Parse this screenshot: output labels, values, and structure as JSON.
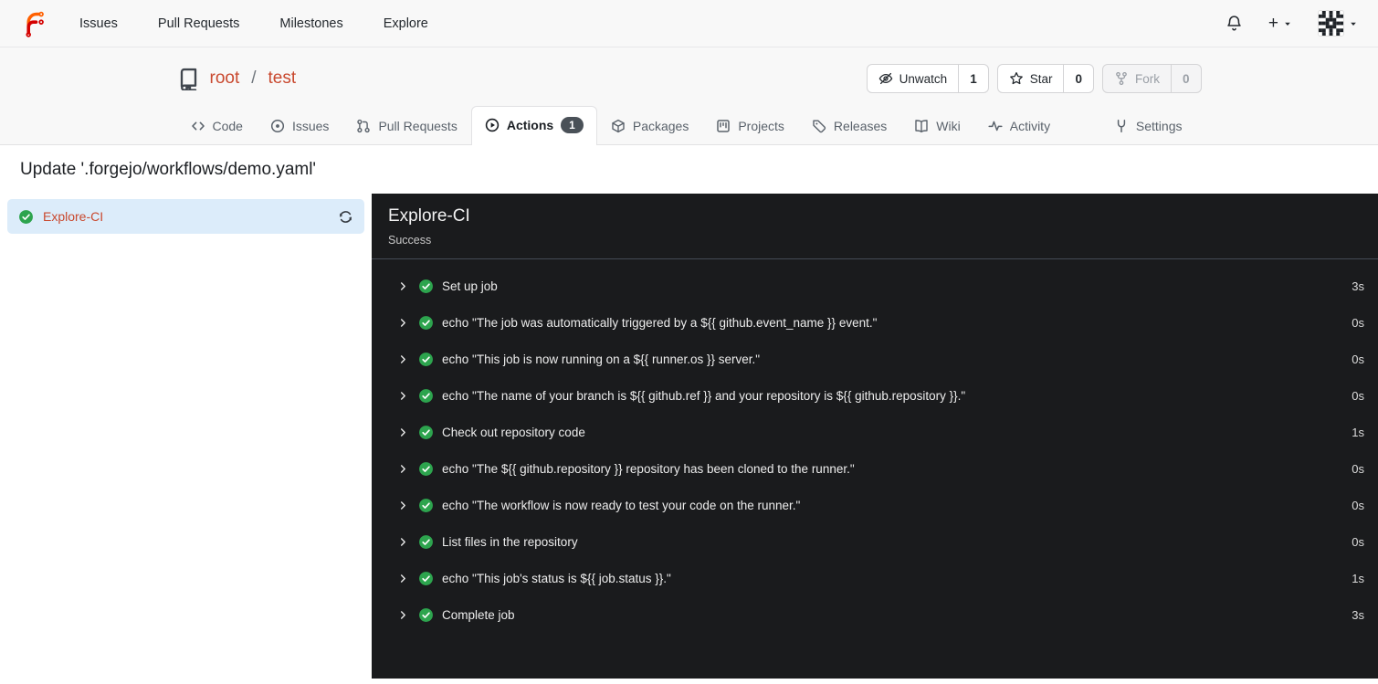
{
  "topnav": {
    "items": [
      {
        "label": "Issues"
      },
      {
        "label": "Pull Requests"
      },
      {
        "label": "Milestones"
      },
      {
        "label": "Explore"
      }
    ],
    "right": {
      "plus_label": "+"
    }
  },
  "repo": {
    "owner": "root",
    "separator": "/",
    "name": "test",
    "actions": [
      {
        "key": "unwatch",
        "label": "Unwatch",
        "count": "1",
        "icon": "eye-slash-icon",
        "disabled": false
      },
      {
        "key": "star",
        "label": "Star",
        "count": "0",
        "icon": "star-icon",
        "disabled": false
      },
      {
        "key": "fork",
        "label": "Fork",
        "count": "0",
        "icon": "fork-icon",
        "disabled": true
      }
    ]
  },
  "tabs": [
    {
      "label": "Code",
      "icon": "code-icon",
      "active": false
    },
    {
      "label": "Issues",
      "icon": "issue-icon",
      "active": false
    },
    {
      "label": "Pull Requests",
      "icon": "pull-request-icon",
      "active": false
    },
    {
      "label": "Actions",
      "icon": "play-circle-icon",
      "active": true,
      "badge": "1"
    },
    {
      "label": "Packages",
      "icon": "package-icon",
      "active": false
    },
    {
      "label": "Projects",
      "icon": "project-icon",
      "active": false
    },
    {
      "label": "Releases",
      "icon": "tag-icon",
      "active": false
    },
    {
      "label": "Wiki",
      "icon": "book-icon",
      "active": false
    },
    {
      "label": "Activity",
      "icon": "pulse-icon",
      "active": false
    },
    {
      "label": "Settings",
      "icon": "tools-icon",
      "active": false,
      "right": true
    }
  ],
  "run": {
    "title": "Update '.forgejo/workflows/demo.yaml'",
    "job": {
      "name": "Explore-CI",
      "status": "success"
    },
    "panel": {
      "title": "Explore-CI",
      "status_text": "Success"
    },
    "steps": [
      {
        "name": "Set up job",
        "duration": "3s"
      },
      {
        "name": "echo \"The job was automatically triggered by a ${{ github.event_name }} event.\"",
        "duration": "0s"
      },
      {
        "name": "echo \"This job is now running on a ${{ runner.os }} server.\"",
        "duration": "0s"
      },
      {
        "name": "echo \"The name of your branch is ${{ github.ref }} and your repository is ${{ github.repository }}.\"",
        "duration": "0s"
      },
      {
        "name": "Check out repository code",
        "duration": "1s"
      },
      {
        "name": "echo \"The ${{ github.repository }} repository has been cloned to the runner.\"",
        "duration": "0s"
      },
      {
        "name": "echo \"The workflow is now ready to test your code on the runner.\"",
        "duration": "0s"
      },
      {
        "name": "List files in the repository",
        "duration": "0s"
      },
      {
        "name": "echo \"This job's status is ${{ job.status }}.\"",
        "duration": "1s"
      },
      {
        "name": "Complete job",
        "duration": "3s"
      }
    ]
  },
  "colors": {
    "accent": "#c9492f",
    "success_green": "#2da44e",
    "selected_job_bg": "#dcecfa",
    "log_panel_bg": "#1a1b1d",
    "badge_bg": "#4a5158",
    "logo_orange": "#ff6000",
    "logo_red": "#d40000"
  }
}
